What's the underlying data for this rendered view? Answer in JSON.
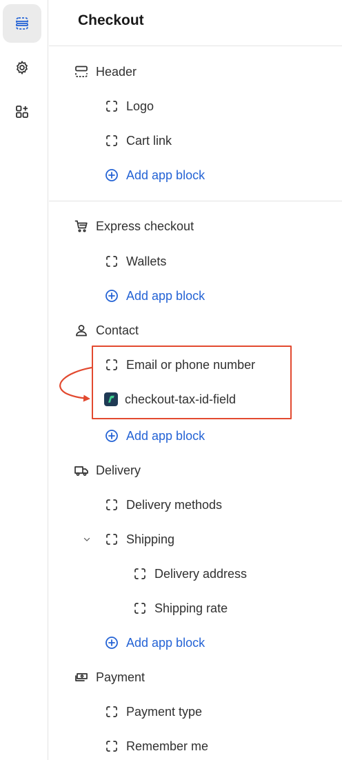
{
  "rail": {
    "items": [
      {
        "icon": "sections-icon",
        "active": true
      },
      {
        "icon": "gear-icon",
        "active": false
      },
      {
        "icon": "apps-add-icon",
        "active": false
      }
    ]
  },
  "panel": {
    "title": "Checkout",
    "header": {
      "label": "Header",
      "children": [
        "Logo",
        "Cart link"
      ],
      "add_label": "Add app block"
    },
    "express": {
      "label": "Express checkout",
      "children": [
        "Wallets"
      ],
      "add_label": "Add app block"
    },
    "contact": {
      "label": "Contact",
      "children": [
        "Email or phone number",
        "checkout-tax-id-field"
      ],
      "add_label": "Add app block"
    },
    "delivery": {
      "label": "Delivery",
      "methods": "Delivery methods",
      "shipping": "Shipping",
      "shipping_children": [
        "Delivery address",
        "Shipping rate"
      ],
      "add_label": "Add app block"
    },
    "payment": {
      "label": "Payment",
      "children": [
        "Payment type",
        "Remember me"
      ]
    }
  },
  "colors": {
    "link": "#2463d5",
    "highlight": "#e2492f",
    "app_icon_bg": "#1f3a55"
  }
}
